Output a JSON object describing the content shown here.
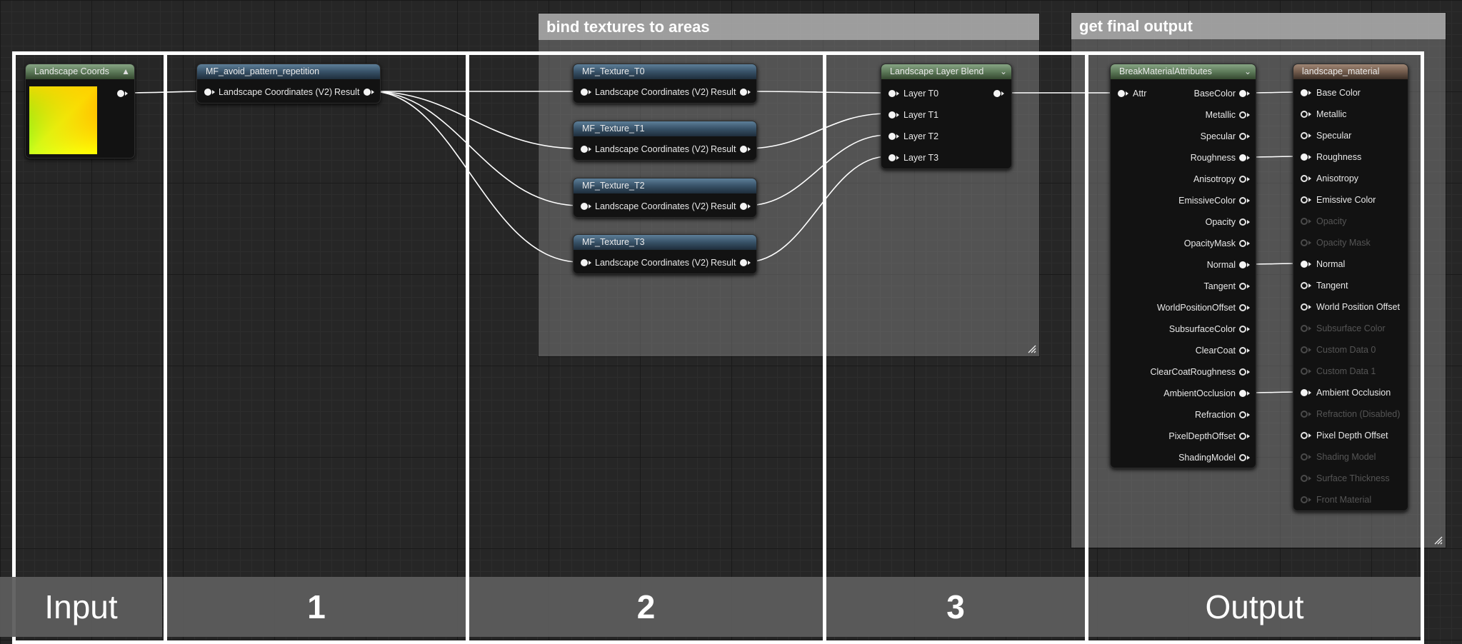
{
  "comments": {
    "bind": {
      "title": "bind textures to areas"
    },
    "final": {
      "title": "get final output"
    }
  },
  "nodes": {
    "landscape_coords": {
      "title": "Landscape Coords"
    },
    "mf_avoid": {
      "title": "MF_avoid_pattern_repetition",
      "input": "Landscape Coordinates (V2)",
      "output": "Result"
    },
    "textures": [
      {
        "title": "MF_Texture_T0",
        "input": "Landscape Coordinates (V2)",
        "output": "Result"
      },
      {
        "title": "MF_Texture_T1",
        "input": "Landscape Coordinates (V2)",
        "output": "Result"
      },
      {
        "title": "MF_Texture_T2",
        "input": "Landscape Coordinates (V2)",
        "output": "Result"
      },
      {
        "title": "MF_Texture_T3",
        "input": "Landscape Coordinates (V2)",
        "output": "Result"
      }
    ],
    "layer_blend": {
      "title": "Landscape Layer Blend",
      "inputs": [
        "Layer T0",
        "Layer T1",
        "Layer T2",
        "Layer T3"
      ]
    },
    "break_attrs": {
      "title": "BreakMaterialAttributes",
      "input": "Attr",
      "outputs": [
        "BaseColor",
        "Metallic",
        "Specular",
        "Roughness",
        "Anisotropy",
        "EmissiveColor",
        "Opacity",
        "OpacityMask",
        "Normal",
        "Tangent",
        "WorldPositionOffset",
        "SubsurfaceColor",
        "ClearCoat",
        "ClearCoatRoughness",
        "AmbientOcclusion",
        "Refraction",
        "PixelDepthOffset",
        "ShadingModel"
      ]
    },
    "material": {
      "title": "landscape_material",
      "inputs": [
        {
          "label": "Base Color",
          "enabled": true
        },
        {
          "label": "Metallic",
          "enabled": true
        },
        {
          "label": "Specular",
          "enabled": true
        },
        {
          "label": "Roughness",
          "enabled": true
        },
        {
          "label": "Anisotropy",
          "enabled": true
        },
        {
          "label": "Emissive Color",
          "enabled": true
        },
        {
          "label": "Opacity",
          "enabled": false
        },
        {
          "label": "Opacity Mask",
          "enabled": false
        },
        {
          "label": "Normal",
          "enabled": true
        },
        {
          "label": "Tangent",
          "enabled": true
        },
        {
          "label": "World Position Offset",
          "enabled": true
        },
        {
          "label": "Subsurface Color",
          "enabled": false
        },
        {
          "label": "Custom Data 0",
          "enabled": false
        },
        {
          "label": "Custom Data 1",
          "enabled": false
        },
        {
          "label": "Ambient Occlusion",
          "enabled": true
        },
        {
          "label": "Refraction (Disabled)",
          "enabled": false
        },
        {
          "label": "Pixel Depth Offset",
          "enabled": true
        },
        {
          "label": "Shading Model",
          "enabled": false
        },
        {
          "label": "Surface Thickness",
          "enabled": false
        },
        {
          "label": "Front Material",
          "enabled": false
        }
      ]
    }
  },
  "sections": [
    {
      "label": "Input",
      "bold": false
    },
    {
      "label": "1",
      "bold": true
    },
    {
      "label": "2",
      "bold": true
    },
    {
      "label": "3",
      "bold": true
    },
    {
      "label": "Output",
      "bold": false
    }
  ],
  "colors": {
    "header_blue": "#375167",
    "header_green": "#5d7a59",
    "header_brown": "#725b4c",
    "wire": "#ffffff",
    "frame": "#ffffff"
  }
}
